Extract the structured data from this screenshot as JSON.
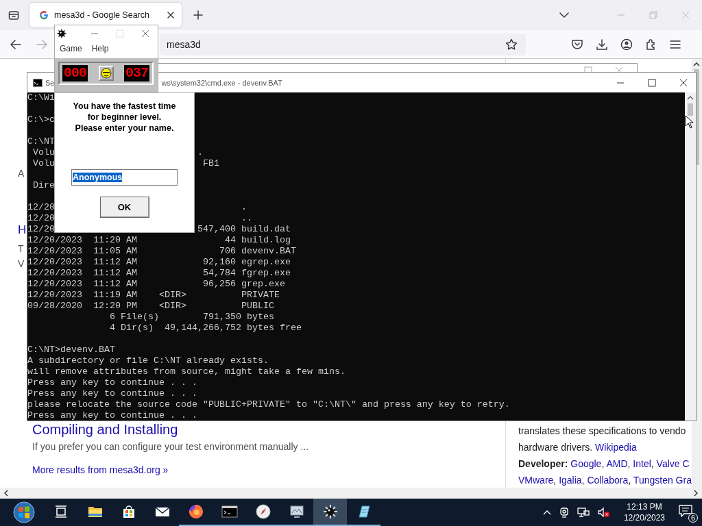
{
  "browser": {
    "tabs": [
      {
        "title": "mesa3d - Google Search",
        "selected": true
      }
    ],
    "address": "mesa3d",
    "forward_disabled": true,
    "page": {
      "edge_letters": [
        {
          "kind": "text",
          "text": "A"
        },
        {
          "kind": "heading",
          "text": "H"
        },
        {
          "kind": "text",
          "text": "T"
        },
        {
          "kind": "text",
          "text": "V"
        }
      ],
      "result": {
        "title": "Compiling and Installing",
        "snippet": "If you prefer you can configure your test environment manually ...",
        "more": "More results from mesa3d.org »"
      },
      "panel": {
        "line_1": "translates these specifications to vendo",
        "line_2": "hardware drivers.",
        "source": "Wikipedia",
        "label": "Developer:",
        "separator": ", ",
        "developers_1": [
          "Google",
          "AMD",
          "Intel",
          "Valve C"
        ],
        "developers_2": [
          "VMware",
          "Igalia",
          "Collabora",
          "Tungsten Gra"
        ]
      }
    }
  },
  "cmd": {
    "title_parts": [
      "Se",
      "ws\\system32\\cmd.exe - devenv.BAT"
    ],
    "blocks": [
      [
        "C:\\Wi"
      ],
      [
        "C:\\>c"
      ],
      [
        "C:\\NT",
        " Volu                          .",
        " Volu                           FB1"
      ],
      [
        " Dire"
      ],
      [
        "12/20                                  .",
        "12/20                                  ..",
        "12/20                          547,400 build.dat",
        "12/20/2023  11:20 AM                44 build.log",
        "12/20/2023  11:05 AM               706 devenv.BAT",
        "12/20/2023  11:12 AM            92,160 egrep.exe",
        "12/20/2023  11:12 AM            54,784 fgrep.exe",
        "12/20/2023  11:12 AM            96,256 grep.exe",
        "12/20/2023  11:19 AM    <DIR>          PRIVATE",
        "09/28/2020  12:20 PM    <DIR>          PUBLIC",
        "               6 File(s)        791,350 bytes",
        "               4 Dir(s)  49,144,266,752 bytes free"
      ],
      [
        "C:\\NT>devenv.BAT",
        "A subdirectory or file C:\\NT already exists.",
        "will remove attributes from source, might take a few mins.",
        "Press any key to continue . . .",
        "Press any key to continue . . .",
        "please relocate the source code \"PUBLIC+PRIVATE\" to \"C:\\NT\\\" and press any key to retry.",
        "Press any key to continue . . ."
      ]
    ]
  },
  "minesweeper": {
    "menu": [
      "Game",
      "Help"
    ],
    "mines": "000",
    "time": "037"
  },
  "dialog": {
    "message_lines": [
      "You have the fastest time",
      "for beginner level.",
      "Please enter your name."
    ],
    "name": "Anonymous",
    "name_selected": true,
    "ok": "OK"
  },
  "taskbar": {
    "apps": [
      {
        "kind": "taskview",
        "running": false,
        "active": false
      },
      {
        "kind": "folder",
        "running": false,
        "active": false
      },
      {
        "kind": "store",
        "running": false,
        "active": false
      },
      {
        "kind": "mail",
        "running": false,
        "active": false
      },
      {
        "kind": "firefox",
        "running": true,
        "active": false
      },
      {
        "kind": "terminal",
        "running": true,
        "active": false
      },
      {
        "kind": "compass",
        "running": true,
        "active": false
      },
      {
        "kind": "monitor",
        "running": true,
        "active": false
      },
      {
        "kind": "mine",
        "running": true,
        "active": true
      },
      {
        "kind": "pad",
        "running": true,
        "active": false
      }
    ],
    "time": "12:13 PM",
    "date": "12/20/2023",
    "notifications": "6"
  }
}
